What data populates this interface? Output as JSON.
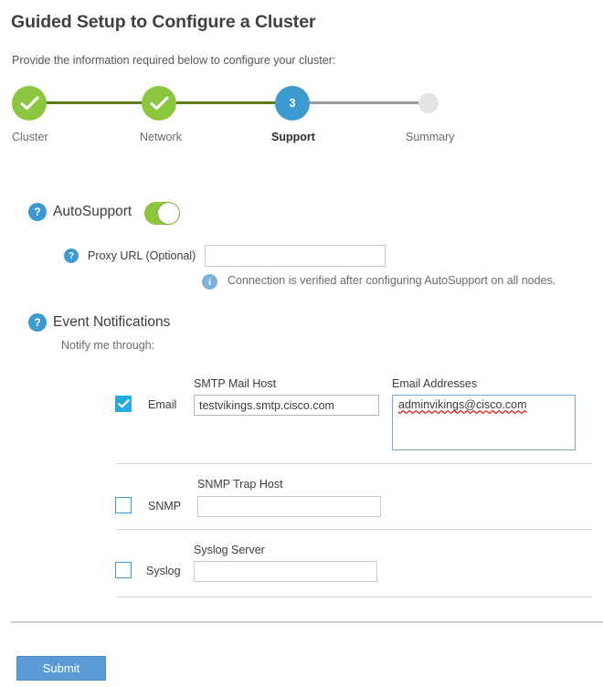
{
  "header": {
    "title": "Guided Setup to Configure a Cluster",
    "subtitle": "Provide the information required below to configure your cluster:"
  },
  "stepper": {
    "steps": [
      {
        "label": "Cluster",
        "state": "done",
        "marker": "check"
      },
      {
        "label": "Network",
        "state": "done",
        "marker": "check"
      },
      {
        "label": "Support",
        "state": "current",
        "marker": "3"
      },
      {
        "label": "Summary",
        "state": "pending",
        "marker": ""
      }
    ],
    "colors": {
      "done": "#8cc63e",
      "current": "#3d9ad1",
      "pending": "#e4e4e2",
      "connector_done": "#5e7c14",
      "connector_todo": "#9a9a9a"
    }
  },
  "autosupport": {
    "help_icon": "question-mark-icon",
    "help_glyph": "?",
    "label": "AutoSupport",
    "toggle_state": "on",
    "toggle_on_color": "#8cc63e",
    "proxy": {
      "help_glyph": "?",
      "label": "Proxy URL (Optional)",
      "value": "",
      "placeholder": ""
    },
    "note": {
      "info_icon": "info-icon",
      "info_glyph": "i",
      "text": "Connection is verified after configuring AutoSupport on all nodes."
    }
  },
  "event_notifications": {
    "help_glyph": "?",
    "heading": "Event Notifications",
    "subheading": "Notify me through:",
    "rows": [
      {
        "name": "email",
        "label": "Email",
        "checked": true,
        "field_label": "SMTP Mail Host",
        "field_value": "testvikings.smtp.cisco.com",
        "extra_label": "Email Addresses",
        "extra_value": "adminvikings@cisco.com"
      },
      {
        "name": "snmp",
        "label": "SNMP",
        "checked": false,
        "field_label": "SNMP Trap Host",
        "field_value": ""
      },
      {
        "name": "syslog",
        "label": "Syslog",
        "checked": false,
        "field_label": "Syslog Server",
        "field_value": ""
      }
    ]
  },
  "footer": {
    "submit_label": "Submit",
    "submit_color": "#5b9bd5"
  }
}
